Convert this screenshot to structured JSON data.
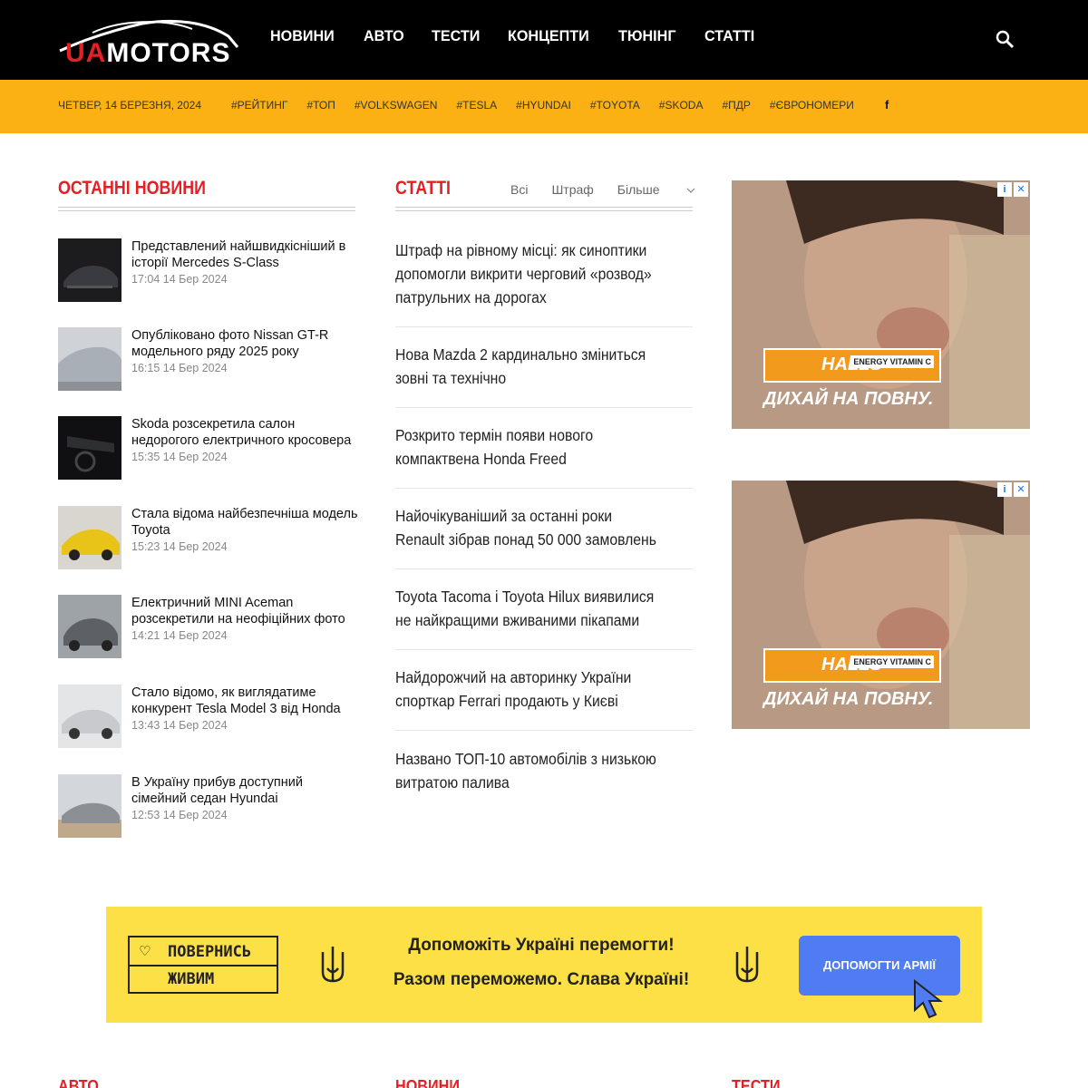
{
  "header": {
    "logo_text_ua": "UA",
    "logo_text_rest": "MOTORS",
    "nav": [
      "НОВИНИ",
      "АВТО",
      "ТЕСТИ",
      "КОНЦЕПТИ",
      "ТЮНІНГ",
      "СТАТТІ"
    ]
  },
  "subbar": {
    "date": "ЧЕТВЕР, 14 БЕРЕЗНЯ, 2024",
    "tags": [
      "#РЕЙТИНГ",
      "#ТОП",
      "#VOLKSWAGEN",
      "#TESLA",
      "#HYUNDAI",
      "#TOYOTA",
      "#SKODA",
      "#ПДР",
      "#ЄВРОНОМЕРИ"
    ],
    "social": "f"
  },
  "latest": {
    "title": "ОСТАННІ НОВИНИ",
    "items": [
      {
        "title": "Представлений найшвидкісніший в історії Mercedes S-Class",
        "time": "17:04 14 Бер 2024"
      },
      {
        "title": "Опубліковано фото Nissan GT-R модельного ряду 2025 року",
        "time": "16:15 14 Бер 2024"
      },
      {
        "title": "Skoda розсекретила салон недорогого електричного кросовера",
        "time": "15:35 14 Бер 2024"
      },
      {
        "title": "Стала відома найбезпечніша модель Toyota",
        "time": "15:23 14 Бер 2024"
      },
      {
        "title": "Електричний MINI Aceman розсекретили на неофіційних фото",
        "time": "14:21 14 Бер 2024"
      },
      {
        "title": "Стало відомо, як виглядатиме конкурент Tesla Model 3 від Honda",
        "time": "13:43 14 Бер 2024"
      },
      {
        "title": "В Україну прибув доступний сімейний седан Hyundai",
        "time": "12:53 14 Бер 2024"
      }
    ]
  },
  "articles": {
    "title": "СТАТТІ",
    "tabs": [
      "Всі",
      "Штраф",
      "Більше"
    ],
    "items": [
      "Штраф на рівному місці: як синоптики допомогли викрити черговий «розвод» патрульних на дорогах",
      "Нова Mazda 2 кардинально зміниться зовні та технічно",
      "Розкрито термін появи нового компактвена Honda Freed",
      "Найочікуваніший за останні роки Renault зібрав понад 50 000 замовлень",
      "Toyota Tacoma і Toyota Hilux виявилися не найкращими вживаними пікапами",
      "Найдорожчий на авторинку України спорткар Ferrari продають у Києві",
      "Названо ТОП-10 автомобілів з низькою витратою палива"
    ]
  },
  "ads": [
    {
      "brand": "HALLS",
      "badge": "ENERGY VITAMIN C",
      "slogan": "ДИХАЙ НА ПОВНУ."
    },
    {
      "brand": "HALLS",
      "badge": "ENERGY VITAMIN C",
      "slogan": "ДИХАЙ НА ПОВНУ."
    }
  ],
  "banner": {
    "logo_line1": "ПОВЕРНИСЬ",
    "logo_line2": "ЖИВИМ",
    "line1": "Допоможіть Україні перемогти!",
    "line2": "Разом переможемо. Слава Україні!",
    "button": "ДОПОМОГТИ АРМІЇ"
  },
  "bottom_sections": [
    "АВТО",
    "НОВИНИ",
    "ТЕСТИ"
  ],
  "colors": {
    "accent": "#e41f26",
    "subbar": "#fbb113",
    "topbar": "#000000",
    "banner": "#fde046",
    "button": "#4f7cf2"
  }
}
